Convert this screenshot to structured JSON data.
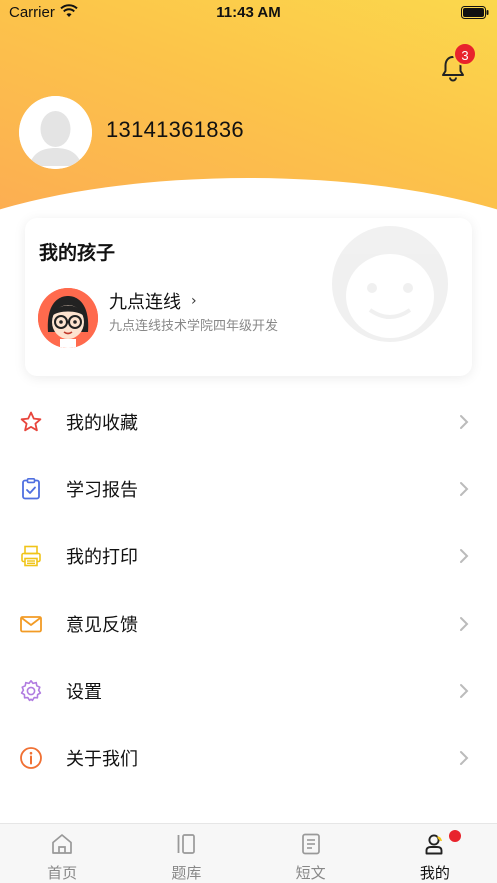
{
  "status_bar": {
    "carrier": "Carrier",
    "time": "11:43 AM"
  },
  "header": {
    "phone": "13141361836",
    "notification_count": "3",
    "gradient_colors": [
      "#fbd84c",
      "#fcae52"
    ]
  },
  "child_card": {
    "title": "我的孩子",
    "child_name": "九点连线",
    "chevron": "›",
    "school": "九点连线技术学院四年级开发"
  },
  "menu": {
    "items": [
      {
        "label": "我的收藏",
        "icon": "star-icon",
        "color": "#e8453c"
      },
      {
        "label": "学习报告",
        "icon": "clipboard-check-icon",
        "color": "#4f6fe0"
      },
      {
        "label": "我的打印",
        "icon": "printer-icon",
        "color": "#f0c419"
      },
      {
        "label": "意见反馈",
        "icon": "mail-icon",
        "color": "#f29b25"
      },
      {
        "label": "设置",
        "icon": "gear-icon",
        "color": "#b07be0"
      },
      {
        "label": "关于我们",
        "icon": "info-icon",
        "color": "#f07033"
      }
    ]
  },
  "tabbar": {
    "tabs": [
      {
        "label": "首页",
        "icon": "home-icon"
      },
      {
        "label": "题库",
        "icon": "library-icon"
      },
      {
        "label": "短文",
        "icon": "document-icon"
      },
      {
        "label": "我的",
        "icon": "profile-icon",
        "active": true
      }
    ]
  }
}
